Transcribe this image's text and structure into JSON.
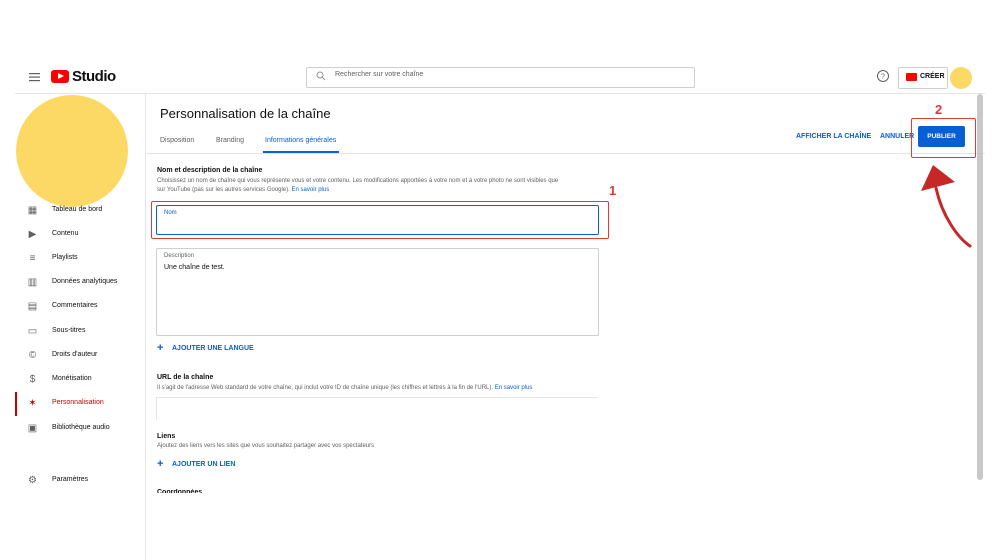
{
  "header": {
    "logo_text": "Studio",
    "search_placeholder": "Rechercher sur votre chaîne",
    "create_label": "CRÉER"
  },
  "sidebar": {
    "items": [
      {
        "label": "Tableau de bord",
        "icon": "dashboard-icon"
      },
      {
        "label": "Contenu",
        "icon": "content-icon"
      },
      {
        "label": "Playlists",
        "icon": "playlist-icon"
      },
      {
        "label": "Données analytiques",
        "icon": "analytics-icon"
      },
      {
        "label": "Commentaires",
        "icon": "comments-icon"
      },
      {
        "label": "Sous-titres",
        "icon": "subtitles-icon"
      },
      {
        "label": "Droits d'auteur",
        "icon": "copyright-icon"
      },
      {
        "label": "Monétisation",
        "icon": "dollar-icon"
      },
      {
        "label": "Personnalisation",
        "icon": "wand-icon",
        "active": true
      },
      {
        "label": "Bibliothèque audio",
        "icon": "audio-library-icon"
      }
    ],
    "settings_label": "Paramètres"
  },
  "main": {
    "title": "Personnalisation de la chaîne",
    "tabs": [
      "Disposition",
      "Branding",
      "Informations générales"
    ],
    "active_tab": "Informations générales",
    "view_channel": "AFFICHER LA CHAÎNE",
    "cancel": "ANNULER",
    "publish": "PUBLIER",
    "name_section": {
      "heading": "Nom et description de la chaîne",
      "desc1": "Choisissez un nom de chaîne qui vous représente vous et votre contenu. Les modifications apportées à votre nom et à votre photo ne sont visibles que",
      "desc2": "sur YouTube (pas sur les autres services Google).",
      "learn_more": "En savoir plus"
    },
    "name_field": {
      "label": "Nom",
      "value": ""
    },
    "description_field": {
      "label": "Description",
      "value": "Une chaîne de test."
    },
    "add_language": "AJOUTER UNE LANGUE",
    "url_section": {
      "heading": "URL de la chaîne",
      "desc": "Il s'agit de l'adresse Web standard de votre chaîne, qui inclut votre ID de chaîne unique (les chiffres et lettres à la fin de l'URL).",
      "learn_more": "En savoir plus"
    },
    "links_section": {
      "heading": "Liens",
      "desc": "Ajoutez des liens vers les sites que vous souhaitez partager avec vos spectateurs",
      "add_link": "AJOUTER UN LIEN"
    },
    "cut_off_heading": "Coordonnées"
  },
  "annotations": {
    "step1": "1",
    "step2": "2",
    "color": "#e53935"
  },
  "colors": {
    "accent": "#065fd4",
    "brand_red": "#ff0000",
    "active_red": "#cc0000",
    "avatar": "#fbd964"
  }
}
